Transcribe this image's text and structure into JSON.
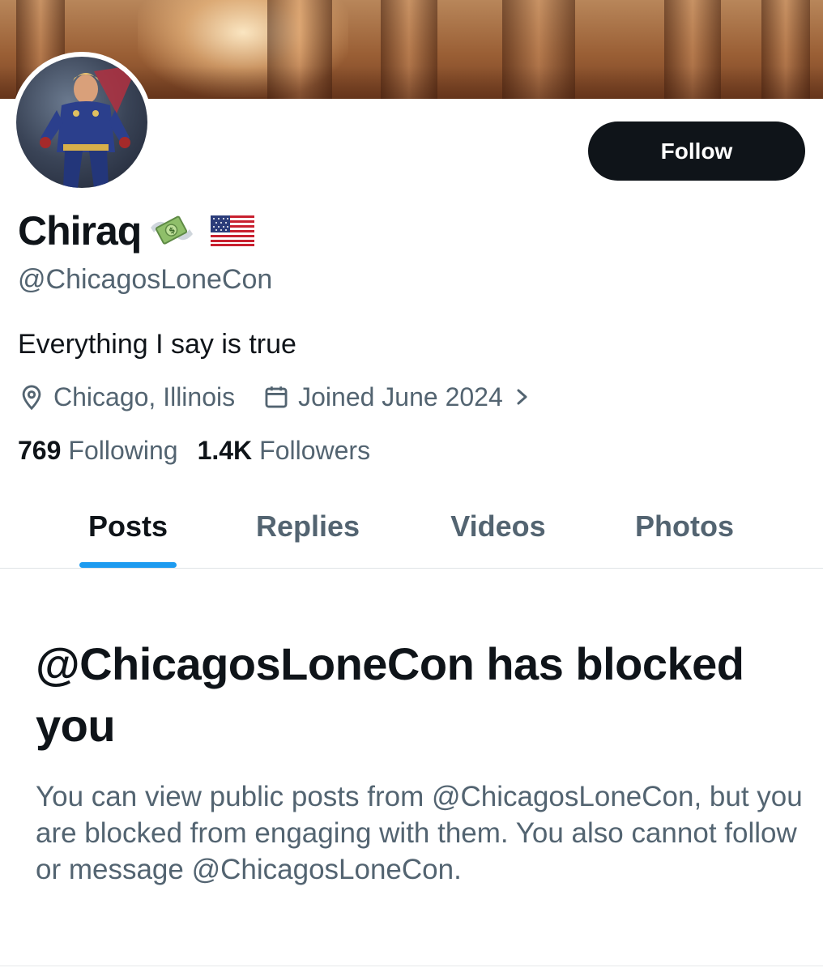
{
  "profile": {
    "display_name": "Chiraq",
    "handle": "@ChicagosLoneCon",
    "bio": "Everything I say is true",
    "location": "Chicago, Illinois",
    "joined": "Joined June 2024",
    "following_count": "769",
    "following_label": "Following",
    "followers_count": "1.4K",
    "followers_label": "Followers",
    "name_emojis": [
      "money-with-wings-emoji",
      "us-flag-emoji"
    ]
  },
  "actions": {
    "follow_label": "Follow"
  },
  "tabs": [
    {
      "label": "Posts",
      "active": true
    },
    {
      "label": "Replies",
      "active": false
    },
    {
      "label": "Videos",
      "active": false
    },
    {
      "label": "Photos",
      "active": false
    }
  ],
  "blocked": {
    "title": "@ChicagosLoneCon has blocked you",
    "body": "You can view public posts from @ChicagosLoneCon, but you are blocked from engaging with them. You also cannot follow or message @ChicagosLoneCon."
  },
  "colors": {
    "text_primary": "#0f1419",
    "text_secondary": "#536471",
    "accent": "#1d9bf0",
    "button_bg": "#0f1419"
  },
  "icons": {
    "location": "location-pin-icon",
    "calendar": "calendar-icon",
    "chevron": "chevron-right-icon"
  }
}
